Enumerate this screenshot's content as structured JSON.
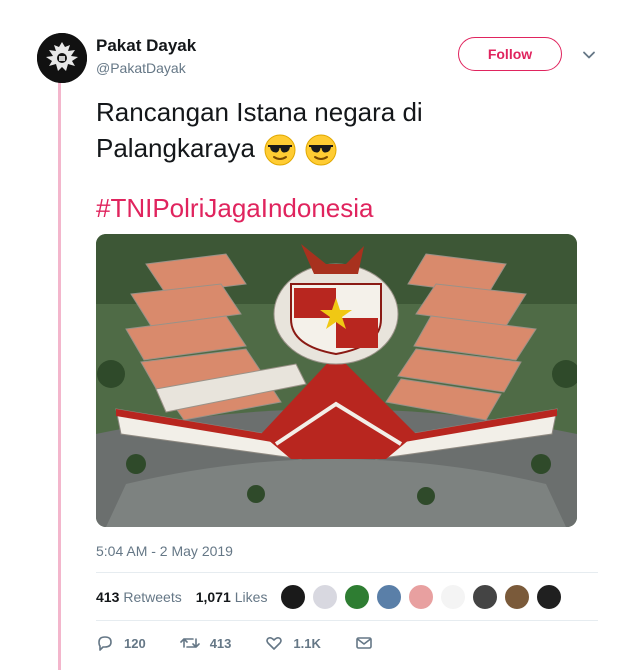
{
  "user": {
    "name": "Pakat Dayak",
    "handle": "@PakatDayak"
  },
  "follow_label": "Follow",
  "tweet": {
    "text_line1": "Rancangan Istana negara di",
    "text_line2": "Palangkaraya",
    "hashtag": "#TNIPolriJagaIndonesia",
    "timestamp": "5:04 AM - 2 May 2019"
  },
  "stats": {
    "retweets_count": "413",
    "retweets_label": "Retweets",
    "likes_count": "1,071",
    "likes_label": "Likes"
  },
  "likers": [
    "#1a1a1a",
    "#d8d8e0",
    "#2e7d32",
    "#5a7fa8",
    "#e8a0a0",
    "#f4f4f4",
    "#444444",
    "#7a5a3a",
    "#202020"
  ],
  "actions": {
    "replies": "120",
    "retweets": "413",
    "likes": "1.1K"
  },
  "colors": {
    "accent": "#e0245e",
    "thread_line": "#f3b6cc",
    "muted": "#657786"
  }
}
